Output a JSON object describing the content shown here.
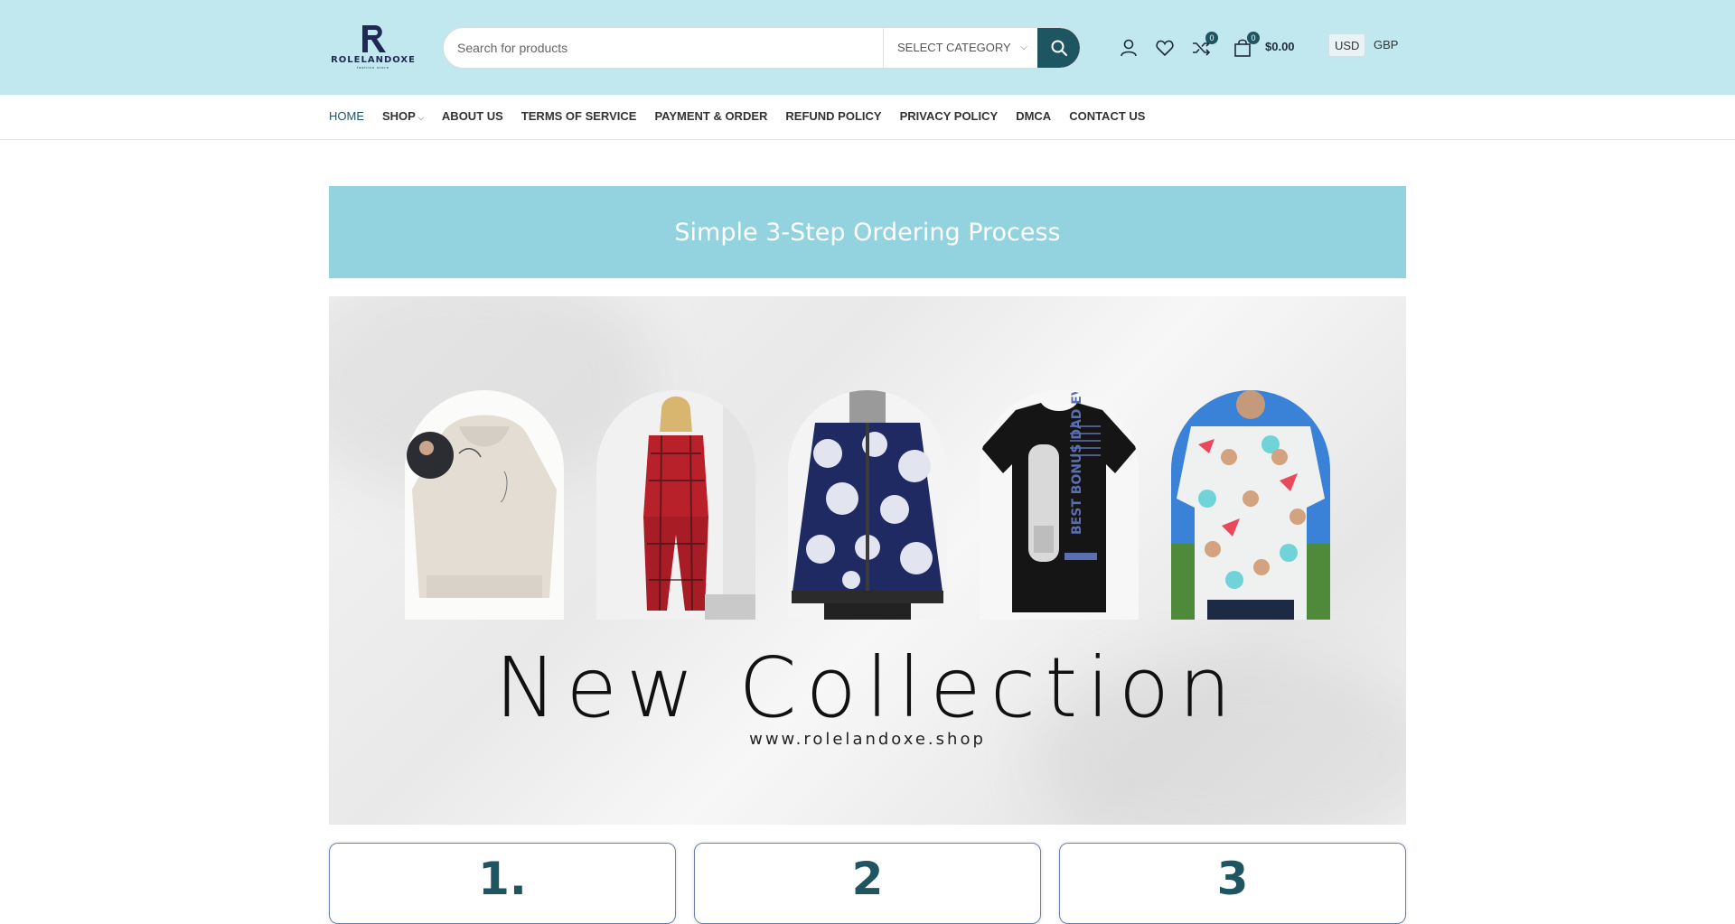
{
  "brand": {
    "name": "ROLELANDOXE",
    "tagline": "fashion store"
  },
  "search": {
    "placeholder": "Search for products",
    "category": "SELECT CATEGORY"
  },
  "header": {
    "compare_count": "0",
    "cart_count": "0",
    "cart_total": "$0.00"
  },
  "currencies": [
    {
      "code": "USD",
      "selected": true
    },
    {
      "code": "GBP",
      "selected": false
    }
  ],
  "nav": {
    "items": [
      "HOME",
      "SHOP",
      "ABOUT US",
      "TERMS OF SERVICE",
      "PAYMENT & ORDER",
      "REFUND POLICY",
      "PRIVACY POLICY",
      "DMCA",
      "CONTACT US"
    ],
    "active": "HOME"
  },
  "banner": {
    "heading": "Simple 3-Step Ordering Process"
  },
  "hero": {
    "title": "New Collection",
    "url": "www.rolelandoxe.shop",
    "products": [
      "custom-hoodie",
      "plaid-pajama-set",
      "floral-bomber-jacket",
      "best-bonus-dad-tshirt",
      "face-print-hawaiian-shirt"
    ],
    "tshirt_text": "BEST BONUS DAD EVER"
  },
  "steps": [
    "1.",
    "2",
    "3"
  ],
  "colors": {
    "header_bg": "#c1e8ef",
    "accent": "#1d5561",
    "banner": "#93d3e0"
  }
}
